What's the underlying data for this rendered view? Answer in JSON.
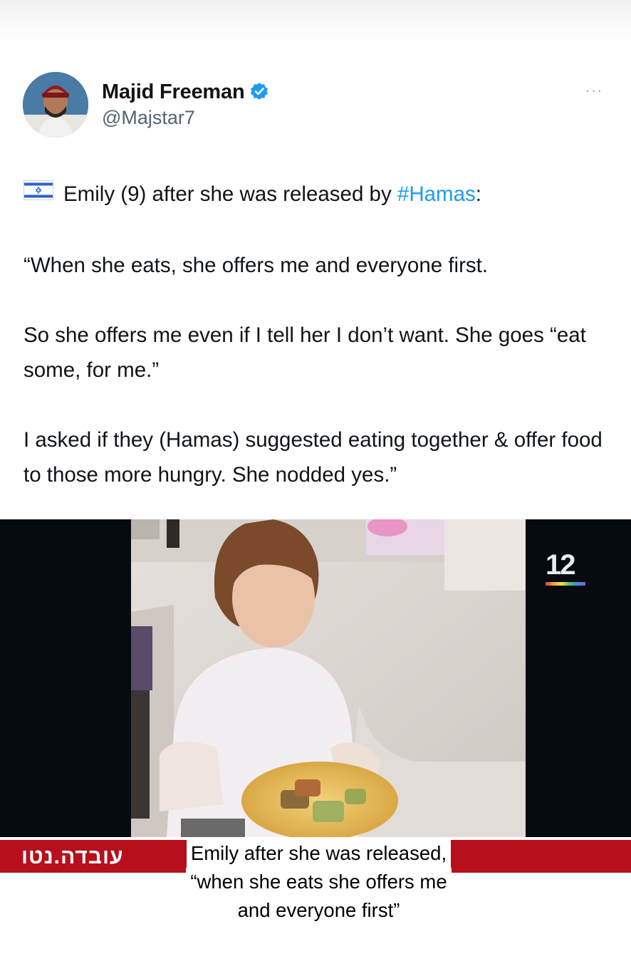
{
  "tweet": {
    "author": {
      "display_name": "Majid Freeman",
      "handle": "@Majstar7",
      "verified": true,
      "avatar_icon": "avatar-photo"
    },
    "more_label": "···",
    "text": {
      "line1_flag_icon": "israel-flag-icon",
      "line1_prefix": "Emily (9) after she was released by ",
      "line1_hashtag": "#Hamas",
      "line1_suffix": ":",
      "paragraph2": "“When she eats, she offers me and everyone first.",
      "paragraph3": "So she offers me even if I tell her I don’t want. She goes “eat some, for me.”",
      "paragraph4": "I asked if they (Hamas) suggested eating together & offer food to those more hungry. She nodded yes.”"
    },
    "accent_color": "#1d9bf0"
  },
  "video": {
    "channel_logo": "12",
    "news_bar_label": "עובדה.נטו",
    "news_bar_color": "#b70f1b",
    "caption_lines": [
      "Emily after she was released,",
      "“when she eats she offers me",
      "and everyone first”"
    ]
  }
}
